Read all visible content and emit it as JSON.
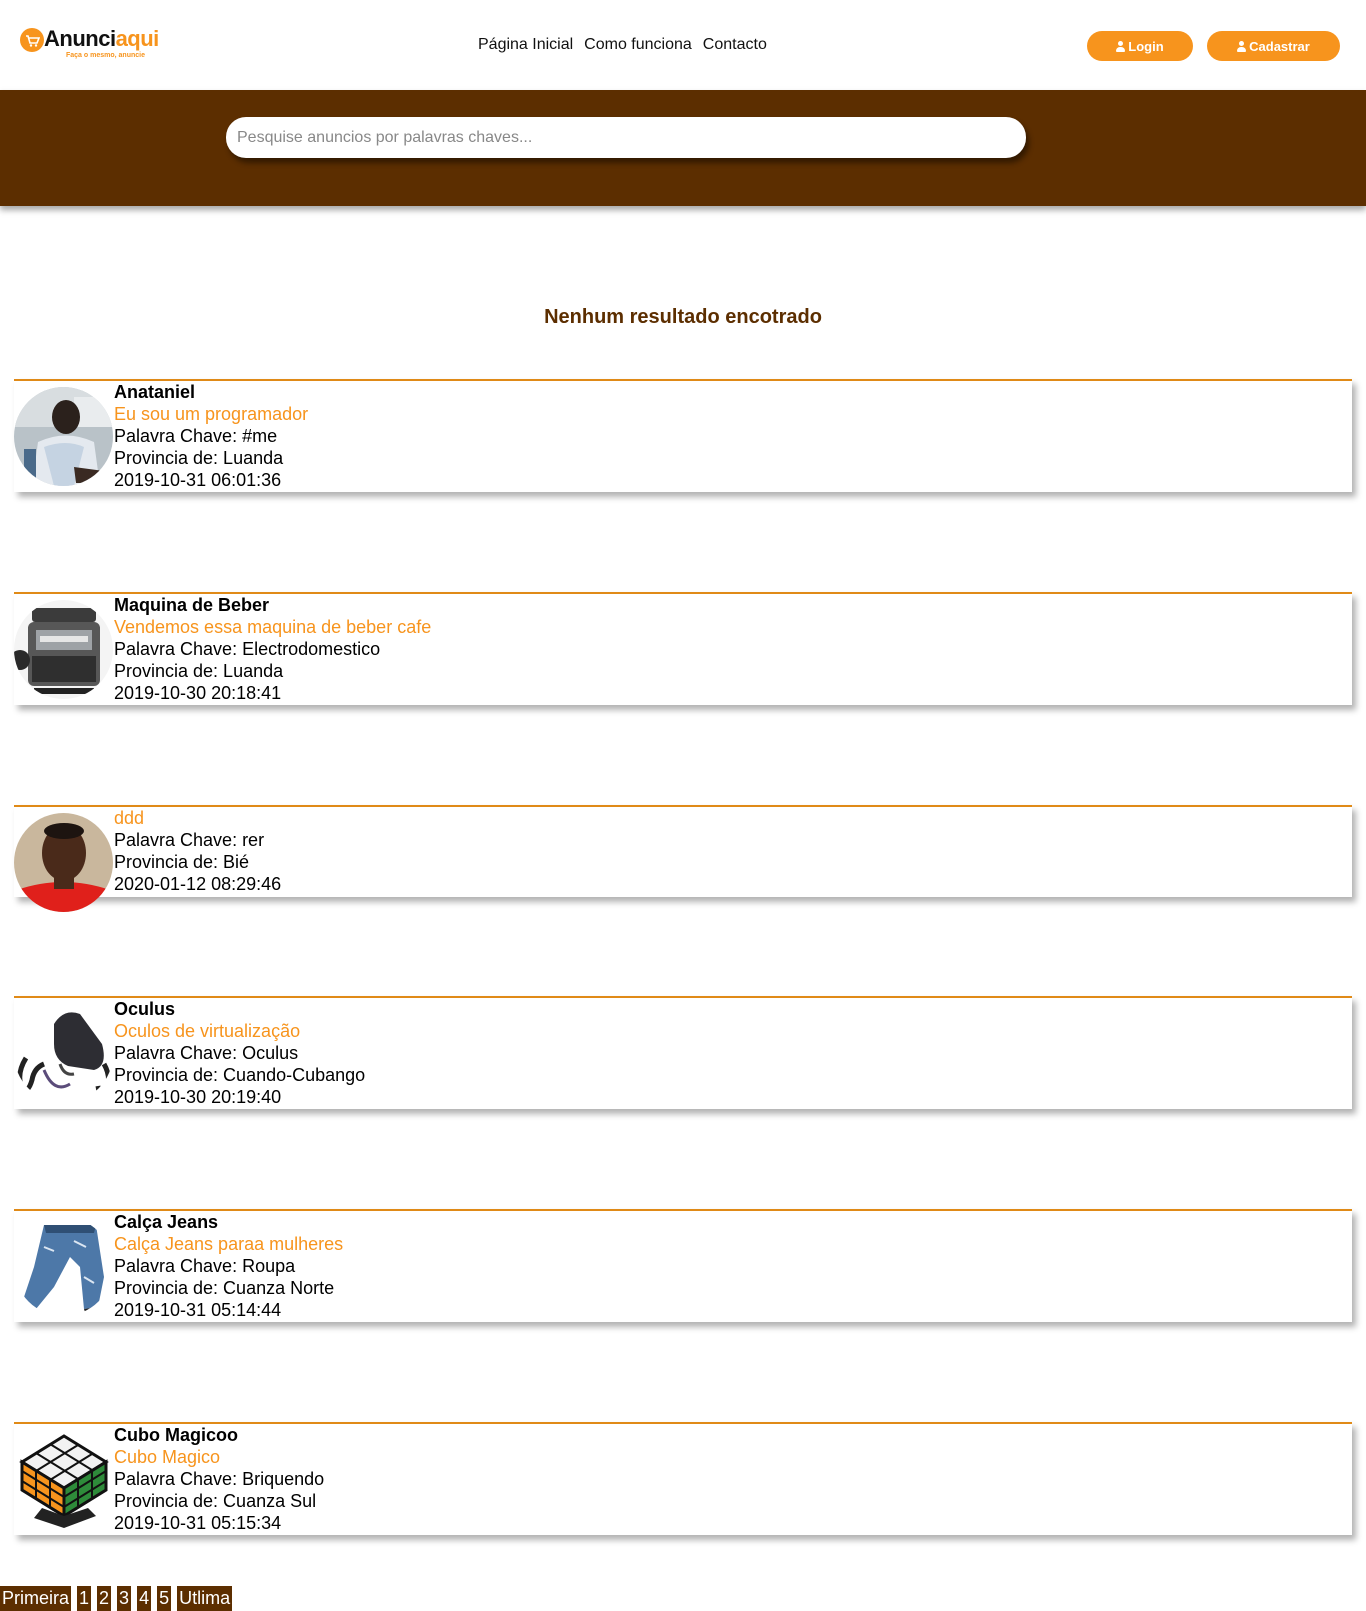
{
  "logo": {
    "text_dark": "Anunci",
    "text_accent": "aqui",
    "tagline": "Faça o mesmo, anuncie"
  },
  "nav": {
    "items": [
      "Página Inicial",
      "Como funciona",
      "Contacto"
    ]
  },
  "buttons": {
    "login": "Login",
    "register": "Cadastrar"
  },
  "search": {
    "placeholder": "Pesquise anuncios por palavras chaves..."
  },
  "message": "Nenhum resultado encotrado",
  "listings": [
    {
      "title": "Anataniel",
      "description": "Eu sou um programador",
      "keyword": "Palavra Chave: #me",
      "province": "Provincia de: Luanda",
      "date": "2019-10-31 06:01:36"
    },
    {
      "title": "Maquina de Beber",
      "description": "Vendemos essa maquina de beber cafe",
      "keyword": "Palavra Chave: Electrodomestico",
      "province": "Provincia de: Luanda",
      "date": "2019-10-30 20:18:41"
    },
    {
      "title": "",
      "description": "ddd",
      "keyword": "Palavra Chave: rer",
      "province": "Provincia de: Bié",
      "date": "2020-01-12 08:29:46"
    },
    {
      "title": "Oculus",
      "description": "Oculos de virtualização",
      "keyword": "Palavra Chave: Oculus",
      "province": "Provincia de: Cuando-Cubango",
      "date": "2019-10-30 20:19:40"
    },
    {
      "title": "Calça Jeans",
      "description": "Calça Jeans paraa mulheres",
      "keyword": "Palavra Chave: Roupa",
      "province": "Provincia de: Cuanza Norte",
      "date": "2019-10-31 05:14:44"
    },
    {
      "title": "Cubo Magicoo",
      "description": "Cubo Magico",
      "keyword": "Palavra Chave: Briquendo",
      "province": "Provincia de: Cuanza Sul",
      "date": "2019-10-31 05:15:34"
    }
  ],
  "pagination": {
    "first": "Primeira",
    "pages": [
      "1",
      "2",
      "3",
      "4",
      "5"
    ],
    "last": "Utlima"
  },
  "colors": {
    "brand_orange": "#f7941d",
    "brand_brown": "#5c2e00"
  }
}
